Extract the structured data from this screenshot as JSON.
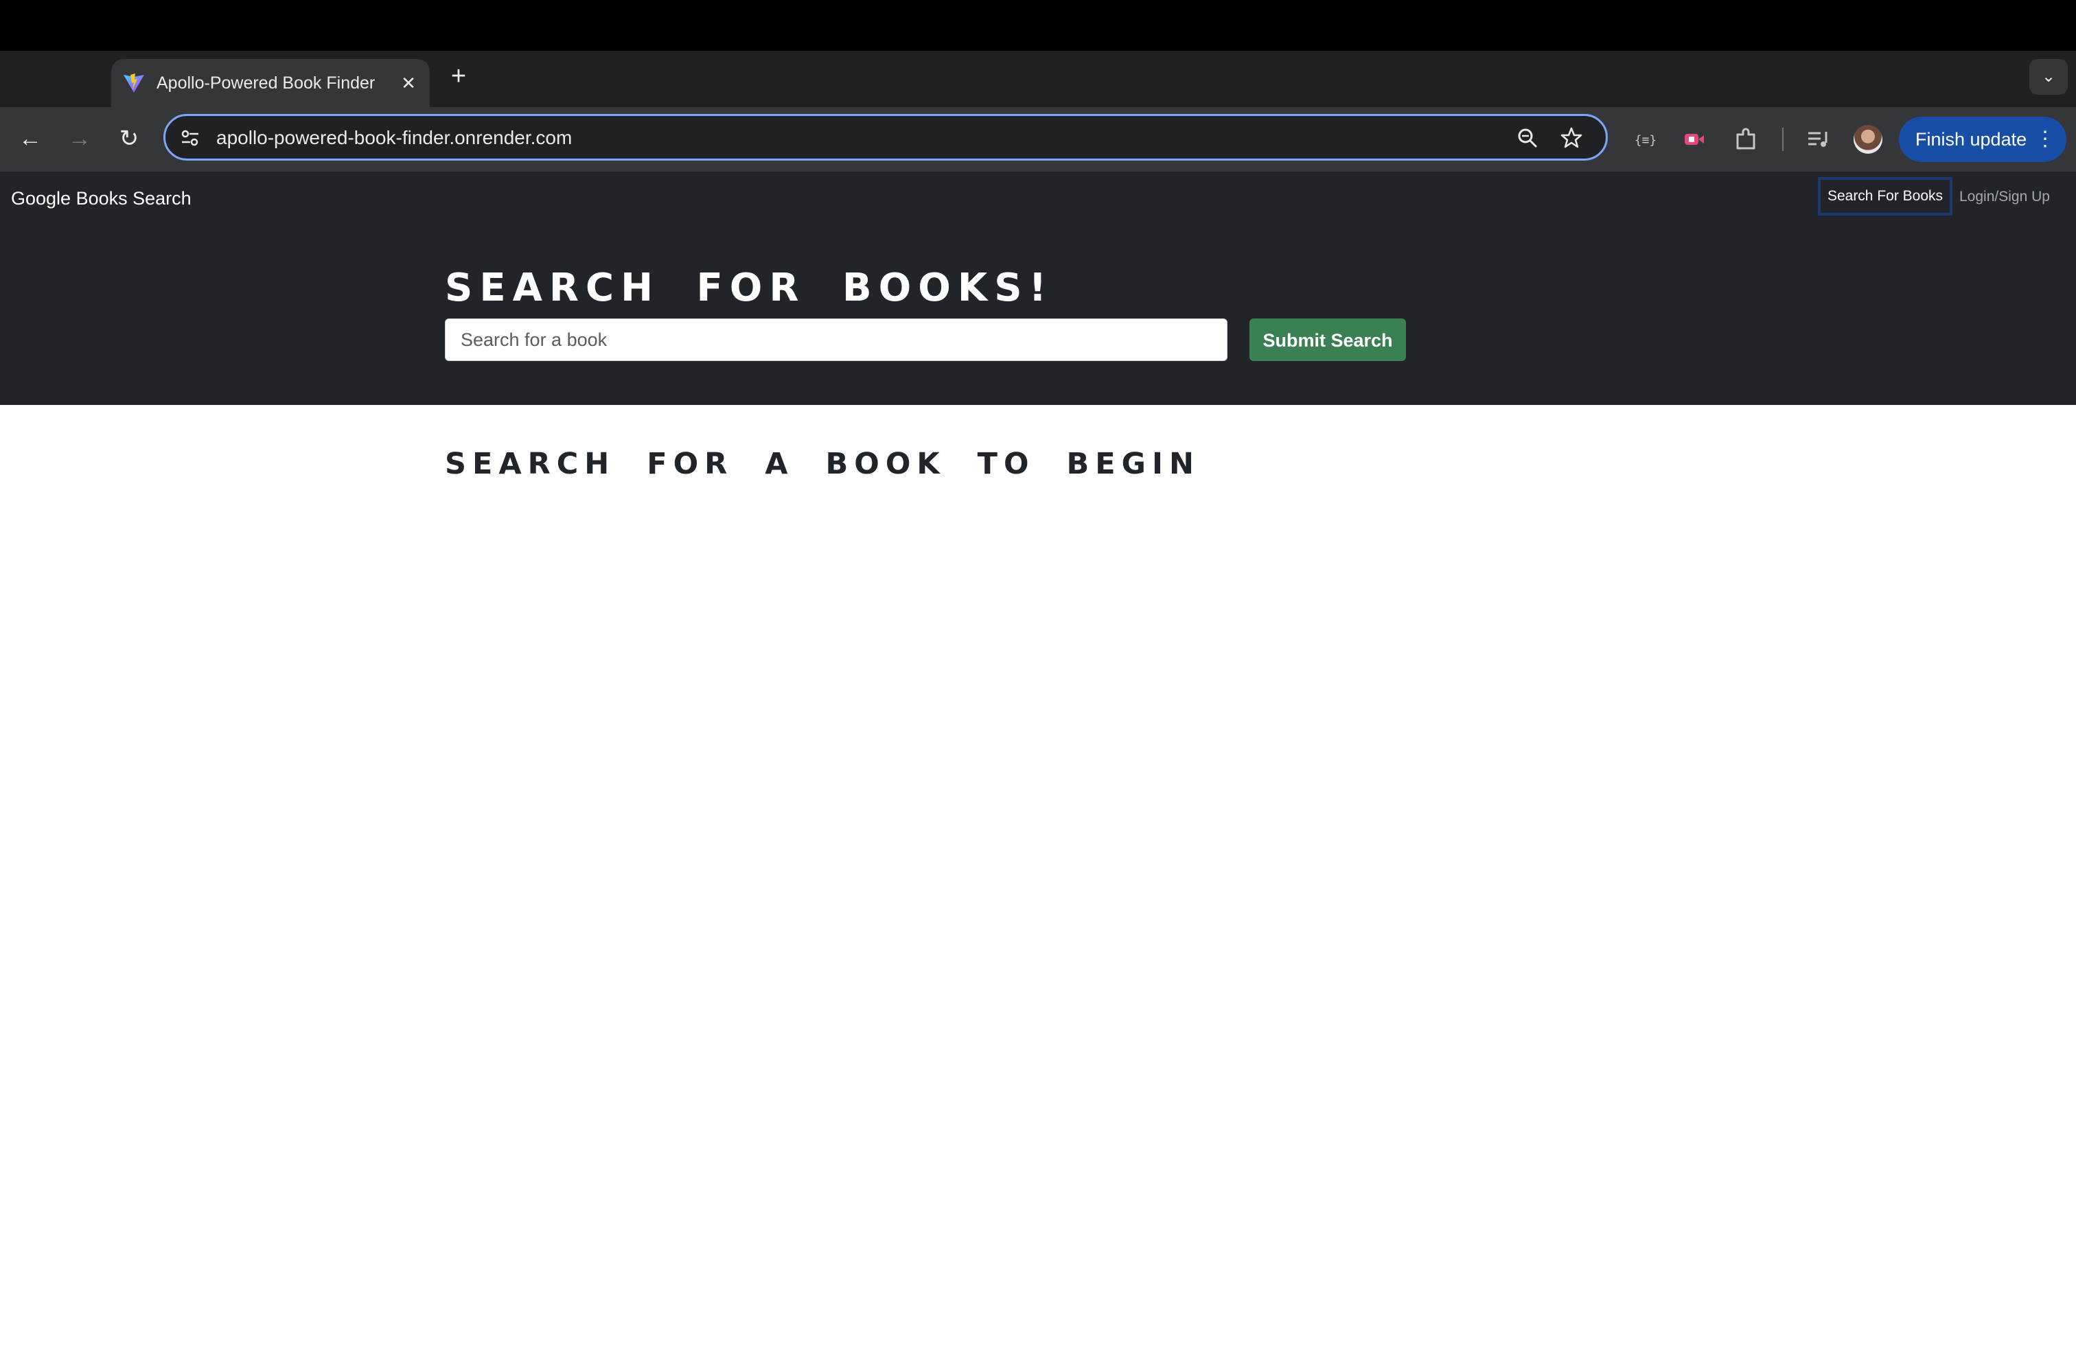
{
  "browser": {
    "tab": {
      "title": "Apollo-Powered Book Finder",
      "favicon": "vite-logo-icon"
    },
    "new_tab_label": "+",
    "address_bar": {
      "url": "apollo-powered-book-finder.onrender.com"
    },
    "update_button": {
      "label": "Finish update"
    },
    "colors": {
      "accent": "#7ea6f7",
      "update_bg": "#174ea6"
    }
  },
  "navbar": {
    "brand": "Google Books Search",
    "links": [
      {
        "label": "Search For Books",
        "active": true
      },
      {
        "label": "Login/Sign Up",
        "active": false
      }
    ]
  },
  "hero": {
    "title": "Search for Books!",
    "search": {
      "placeholder": "Search for a book",
      "value": ""
    },
    "submit_label": "Submit Search"
  },
  "results": {
    "heading": "Search for a book to begin"
  },
  "colors": {
    "page_dark": "#212529",
    "submit_green": "#3a8052"
  }
}
